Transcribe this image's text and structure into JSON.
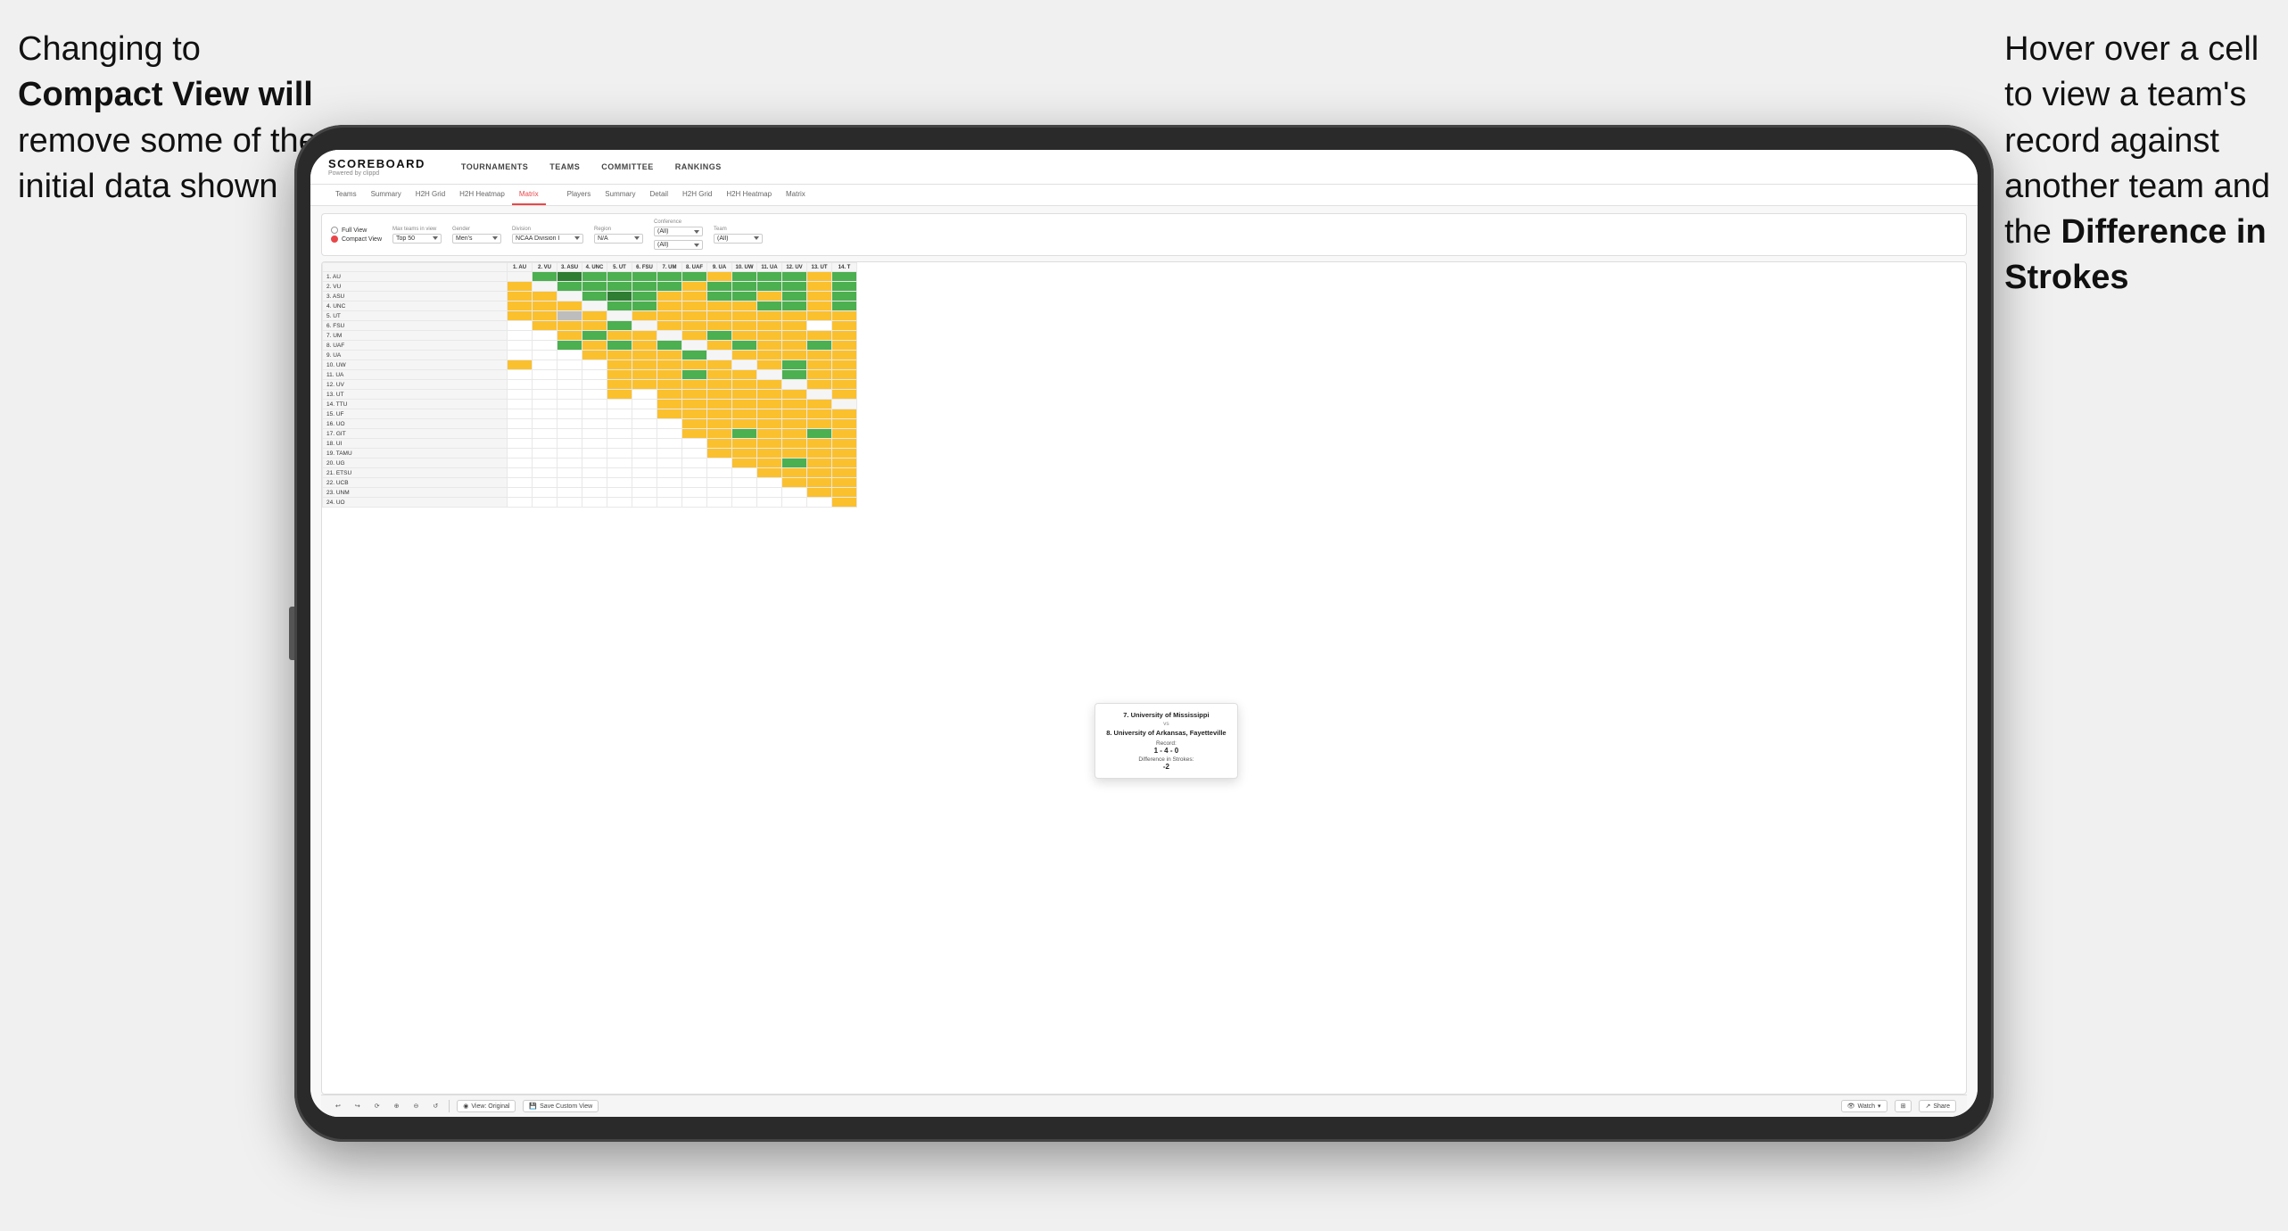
{
  "annotations": {
    "left_line1": "Changing to",
    "left_line2": "Compact View will",
    "left_line3": "remove some of the",
    "left_line4": "initial data shown",
    "right_line1": "Hover over a cell",
    "right_line2": "to view a team's",
    "right_line3": "record against",
    "right_line4": "another team and",
    "right_line5": "the",
    "right_bold": "Difference in",
    "right_line6": "Strokes"
  },
  "app": {
    "logo": "SCOREBOARD",
    "logo_sub": "Powered by clippd",
    "nav": [
      "TOURNAMENTS",
      "TEAMS",
      "COMMITTEE",
      "RANKINGS"
    ]
  },
  "sub_nav": {
    "group1": [
      "Teams",
      "Summary",
      "H2H Grid",
      "H2H Heatmap",
      "Matrix"
    ],
    "group2": [
      "Players",
      "Summary",
      "Detail",
      "H2H Grid",
      "H2H Heatmap",
      "Matrix"
    ]
  },
  "filters": {
    "view_options": [
      "Full View",
      "Compact View"
    ],
    "selected_view": "Compact View",
    "max_teams_label": "Max teams in view",
    "max_teams_value": "Top 50",
    "gender_label": "Gender",
    "gender_value": "Men's",
    "division_label": "Division",
    "division_value": "NCAA Division I",
    "region_label": "Region",
    "region_value": "N/A",
    "conference_label": "Conference",
    "conference_values": [
      "(All)",
      "(All)"
    ],
    "team_label": "Team",
    "team_value": "(All)"
  },
  "matrix": {
    "col_headers": [
      "1. AU",
      "2. VU",
      "3. ASU",
      "4. UNC",
      "5. UT",
      "6. FSU",
      "7. UM",
      "8. UAF",
      "9. UA",
      "10. UW",
      "11. UA",
      "12. UV",
      "13. UT",
      "14. T"
    ],
    "row_labels": [
      "1. AU",
      "2. VU",
      "3. ASU",
      "4. UNC",
      "5. UT",
      "6. FSU",
      "7. UM",
      "8. UAF",
      "9. UA",
      "10. UW",
      "11. UA",
      "12. UV",
      "13. UT",
      "14. TTU",
      "15. UF",
      "16. UO",
      "17. GIT",
      "18. UI",
      "19. TAMU",
      "20. UG",
      "21. ETSU",
      "22. UCB",
      "23. UNM",
      "24. UO"
    ]
  },
  "tooltip": {
    "team1": "7. University of Mississippi",
    "vs": "vs",
    "team2": "8. University of Arkansas, Fayetteville",
    "record_label": "Record:",
    "record_value": "1 - 4 - 0",
    "diff_label": "Difference in Strokes:",
    "diff_value": "-2"
  },
  "toolbar": {
    "undo": "↩",
    "redo": "↪",
    "btn1": "⟳",
    "btn2": "⊕",
    "btn3": "⊖",
    "btn4": "↺",
    "view_original": "View: Original",
    "save_custom": "Save Custom View",
    "watch": "Watch",
    "share": "Share"
  }
}
